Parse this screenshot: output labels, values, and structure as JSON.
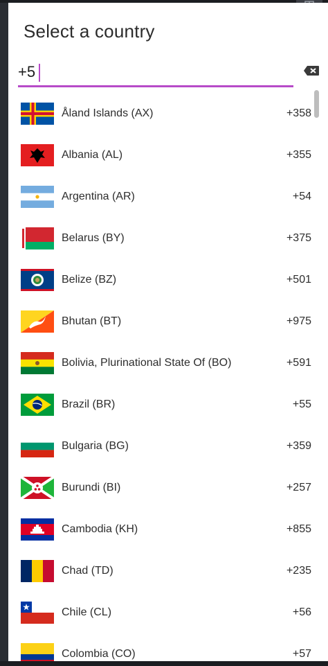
{
  "dialog": {
    "title": "Select a country",
    "search": {
      "value": "+5",
      "placeholder": ""
    },
    "countries": [
      {
        "name": "Åland Islands (AX)",
        "code": "+358",
        "flag_icon": "aland-islands-flag-icon"
      },
      {
        "name": "Albania (AL)",
        "code": "+355",
        "flag_icon": "albania-flag-icon"
      },
      {
        "name": "Argentina (AR)",
        "code": "+54",
        "flag_icon": "argentina-flag-icon"
      },
      {
        "name": "Belarus (BY)",
        "code": "+375",
        "flag_icon": "belarus-flag-icon"
      },
      {
        "name": "Belize (BZ)",
        "code": "+501",
        "flag_icon": "belize-flag-icon"
      },
      {
        "name": "Bhutan (BT)",
        "code": "+975",
        "flag_icon": "bhutan-flag-icon"
      },
      {
        "name": "Bolivia, Plurinational State Of (BO)",
        "code": "+591",
        "flag_icon": "bolivia-flag-icon"
      },
      {
        "name": "Brazil (BR)",
        "code": "+55",
        "flag_icon": "brazil-flag-icon"
      },
      {
        "name": "Bulgaria (BG)",
        "code": "+359",
        "flag_icon": "bulgaria-flag-icon"
      },
      {
        "name": "Burundi (BI)",
        "code": "+257",
        "flag_icon": "burundi-flag-icon"
      },
      {
        "name": "Cambodia (KH)",
        "code": "+855",
        "flag_icon": "cambodia-flag-icon"
      },
      {
        "name": "Chad (TD)",
        "code": "+235",
        "flag_icon": "chad-flag-icon"
      },
      {
        "name": "Chile (CL)",
        "code": "+56",
        "flag_icon": "chile-flag-icon"
      },
      {
        "name": "Colombia (CO)",
        "code": "+57",
        "flag_icon": "colombia-flag-icon"
      }
    ]
  },
  "colors": {
    "accent": "#b74ac8",
    "text": "#2d2d2d"
  }
}
